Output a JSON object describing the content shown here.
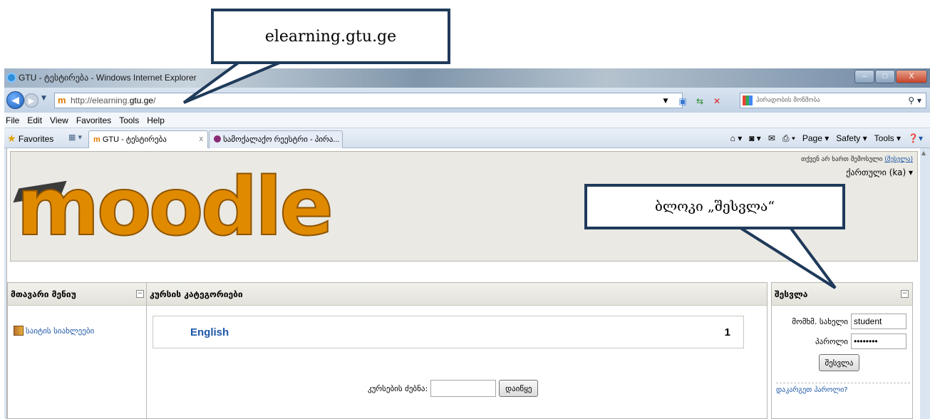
{
  "annotations": {
    "top_callout": "elearning.gtu.ge",
    "login_callout": "ბლოკი „შესვლა“"
  },
  "window": {
    "title": "GTU - ტესტირება - Windows Internet Explorer",
    "controls": {
      "minimize": "–",
      "maximize": "□",
      "close": "X"
    }
  },
  "address": {
    "url_prefix": "http://elearning.",
    "url_domain": "gtu.ge",
    "url_suffix": "/",
    "search_placeholder": "პირადობის მოწმობა"
  },
  "menu": [
    "File",
    "Edit",
    "View",
    "Favorites",
    "Tools",
    "Help"
  ],
  "favorites_bar": {
    "favorites_label": "Favorites",
    "tabs": [
      {
        "label": "GTU - ტესტირება",
        "active": true
      },
      {
        "label": "სამოქალაქო რეესტრი - პირა...",
        "active": false
      }
    ],
    "commands": [
      "Page ▾",
      "Safety ▾",
      "Tools ▾"
    ]
  },
  "moodle": {
    "logo_text": "moodle",
    "login_info_text": "თქვენ არ ხართ შემოსული",
    "login_info_link": "(შესვლა)",
    "language": "ქართული (ka)"
  },
  "main_menu": {
    "title": "მთავარი მენიუ",
    "item": "საიტის სიახლეები"
  },
  "course_categories": {
    "title": "კურსის კატეგორიები",
    "category_name": "English",
    "category_count": "1",
    "search_label": "კურსების ძებნა:",
    "search_button": "დაიწყე"
  },
  "login_block": {
    "title": "შესვლა",
    "username_label": "მომხმ. სახელი",
    "username_value": "student",
    "password_label": "პაროლი",
    "password_value": "••••••••",
    "submit": "შესვლა",
    "forgot": "დაკარგეთ პაროლი?"
  }
}
